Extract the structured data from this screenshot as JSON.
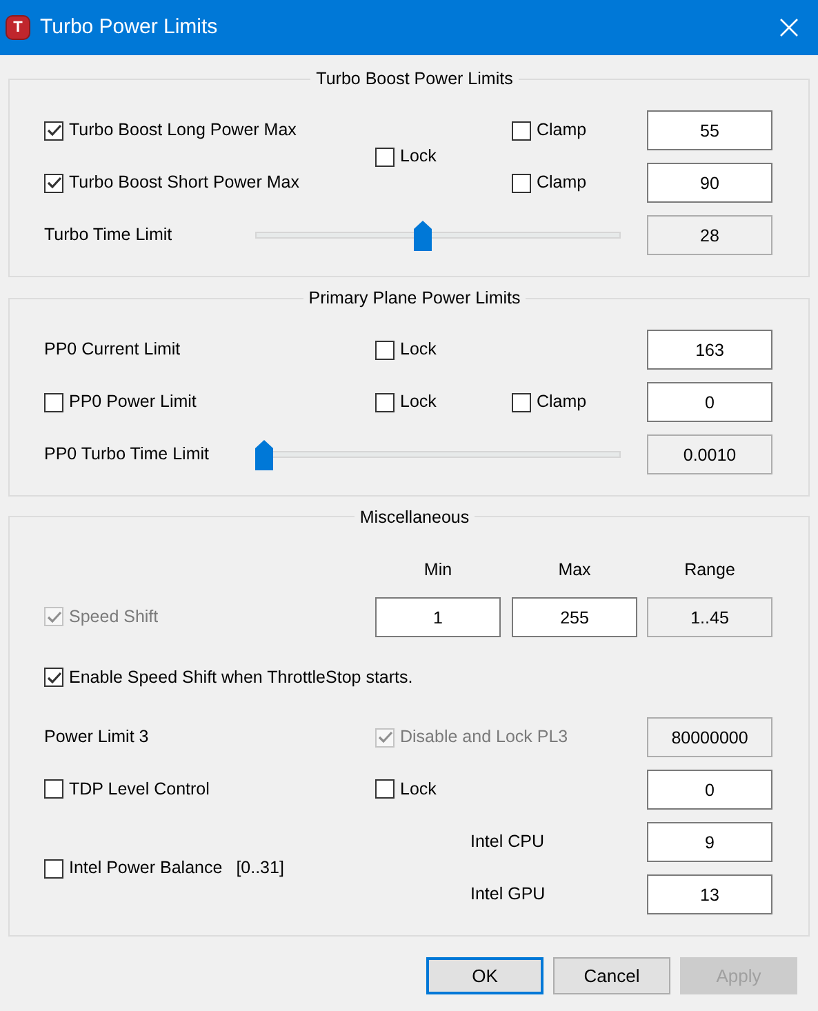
{
  "window": {
    "title": "Turbo Power Limits",
    "icon_letter": "T"
  },
  "turbo_boost": {
    "title": "Turbo Boost Power Limits",
    "long_power": {
      "label": "Turbo Boost Long Power Max",
      "checked": true,
      "clamp": {
        "label": "Clamp",
        "checked": false
      },
      "value": "55",
      "readonly": false
    },
    "short_power": {
      "label": "Turbo Boost Short Power Max",
      "checked": true,
      "clamp": {
        "label": "Clamp",
        "checked": false
      },
      "value": "90",
      "readonly": false
    },
    "lock": {
      "label": "Lock",
      "checked": false
    },
    "time_limit": {
      "label": "Turbo Time Limit",
      "level": 0.46,
      "value": "28",
      "readonly": true
    }
  },
  "primary_plane": {
    "title": "Primary Plane Power Limits",
    "current_limit": {
      "label": "PP0 Current Limit",
      "lock": {
        "label": "Lock",
        "checked": false
      },
      "value": "163",
      "readonly": false
    },
    "power_limit": {
      "label": "PP0 Power Limit",
      "checked": false,
      "lock": {
        "label": "Lock",
        "checked": false
      },
      "clamp": {
        "label": "Clamp",
        "checked": false
      },
      "value": "0",
      "readonly": false
    },
    "time_limit": {
      "label": "PP0 Turbo Time Limit",
      "level": 0,
      "value": "0.0010",
      "readonly": true
    }
  },
  "miscellaneous": {
    "title": "Miscellaneous",
    "headers": [
      "Min",
      "Max",
      "Range"
    ],
    "speed_shift": {
      "label": "Speed Shift",
      "checked": true,
      "disabled": true,
      "min": "1",
      "max": "255",
      "range": "1..45"
    },
    "enable_speed_shift": {
      "label": "Enable Speed Shift when ThrottleStop starts.",
      "checked": true,
      "disabled": false
    },
    "power_limit_3": {
      "label": "Power Limit 3",
      "disable_lock": {
        "label": "Disable and Lock PL3",
        "checked": true,
        "disabled": true
      },
      "value": "80000000",
      "readonly": true
    },
    "tdp_level": {
      "label": "TDP Level Control",
      "checked": false,
      "lock": {
        "label": "Lock",
        "checked": false
      },
      "value": "0",
      "readonly": false
    },
    "power_balance": {
      "label": "Intel Power Balance",
      "range": "[0..31]",
      "checked": false,
      "cpu_label": "Intel CPU",
      "cpu_value": "9",
      "gpu_label": "Intel GPU",
      "gpu_value": "13"
    }
  },
  "buttons": [
    {
      "label": "OK",
      "default": true,
      "disabled": false
    },
    {
      "label": "Cancel",
      "default": false,
      "disabled": false
    },
    {
      "label": "Apply",
      "default": false,
      "disabled": true
    }
  ]
}
